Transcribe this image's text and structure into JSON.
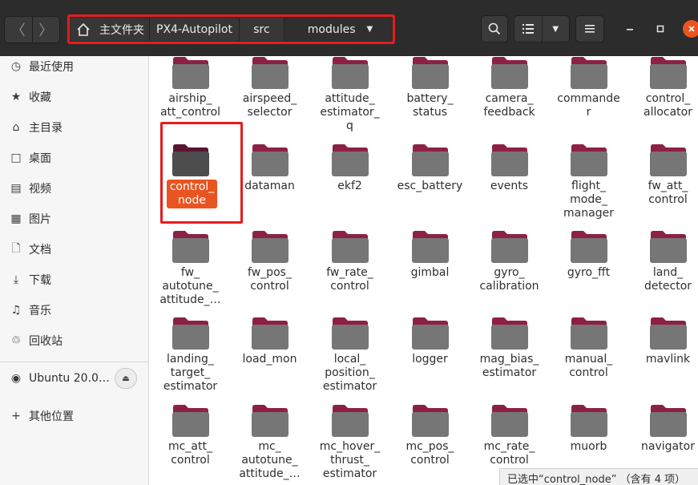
{
  "nav": {
    "back_icon": "chevron-left-icon",
    "forward_icon": "chevron-right-icon"
  },
  "pathbar": {
    "home_icon": "home-icon",
    "crumbs": [
      "主文件夹",
      "PX4-Autopilot",
      "src",
      "modules"
    ],
    "dropdown_icon": "triangle-down-icon"
  },
  "toolbar": {
    "search_icon": "search-icon",
    "list_view_icon": "list-view-icon",
    "view_options_icon": "triangle-down-icon",
    "menu_icon": "hamburger-menu-icon",
    "minimize_icon": "minimize-icon",
    "maximize_icon": "maximize-icon",
    "close_icon": "close-icon"
  },
  "sidebar": {
    "items": [
      {
        "label": "最近使用",
        "icon": "clock-icon"
      },
      {
        "label": "收藏",
        "icon": "star-icon"
      },
      {
        "label": "主目录",
        "icon": "home-icon"
      },
      {
        "label": "桌面",
        "icon": "desktop-icon"
      },
      {
        "label": "视频",
        "icon": "video-icon"
      },
      {
        "label": "图片",
        "icon": "image-icon"
      },
      {
        "label": "文档",
        "icon": "document-icon"
      },
      {
        "label": "下载",
        "icon": "download-icon"
      },
      {
        "label": "音乐",
        "icon": "music-icon"
      },
      {
        "label": "回收站",
        "icon": "trash-icon"
      },
      {
        "label": "Ubuntu 20.0…",
        "icon": "disk-icon"
      },
      {
        "label": "其他位置",
        "icon": "plus-icon"
      }
    ],
    "eject_icon": "eject-icon"
  },
  "folders": [
    "airship_\natt_control",
    "airspeed_\nselector",
    "attitude_\nestimator_\nq",
    "battery_\nstatus",
    "camera_\nfeedback",
    "commande\nr",
    "control_\nallocator",
    "control_\nnode",
    "dataman",
    "ekf2",
    "esc_battery",
    "events",
    "flight_\nmode_\nmanager",
    "fw_att_\ncontrol",
    "fw_\nautotune_\nattitude_…",
    "fw_pos_\ncontrol",
    "fw_rate_\ncontrol",
    "gimbal",
    "gyro_\ncalibration",
    "gyro_fft",
    "land_\ndetector",
    "landing_\ntarget_\nestimator",
    "load_mon",
    "local_\nposition_\nestimator",
    "logger",
    "mag_bias_\nestimator",
    "manual_\ncontrol",
    "mavlink",
    "mc_att_\ncontrol",
    "mc_\nautotune_\nattitude_…",
    "mc_hover_\nthrust_\nestimator",
    "mc_pos_\ncontrol",
    "mc_rate_\ncontrol",
    "muorb",
    "navigator"
  ],
  "selected_folder": "control_\nnode",
  "status": "已选中“control_node” （含有 4 项）",
  "colors": {
    "accent": "#e95420",
    "folder_tab": "#8c2046",
    "folder_body": "#767676",
    "selected_folder": "#4d4d4d",
    "annotation_red": "#e41d1d"
  }
}
